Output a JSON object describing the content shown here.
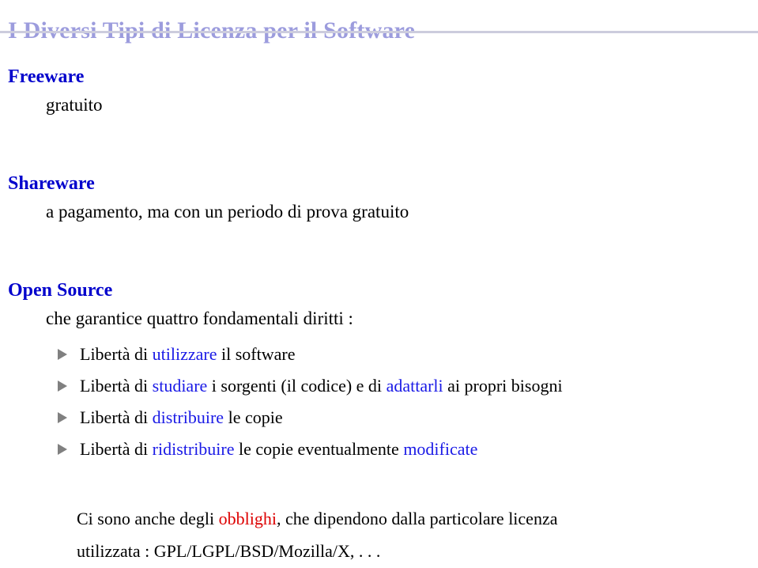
{
  "slide": {
    "title": "I Diversi Tipi di Licenza per il Software",
    "title_color": "#9c9cdd",
    "rule_color": "#ccccdd",
    "heading_color": "#0000cc",
    "keyword_color": "#1a1ae6",
    "obligation_color": "#dd0000",
    "bullet_marker_color": "#808080",
    "bullet_icon": "triangle-right-icon",
    "background": "#ffffff"
  },
  "sections": [
    {
      "heading": "Freeware",
      "body": "gratuito"
    },
    {
      "heading": "Shareware",
      "body": "a pagamento, ma con un periodo di prova gratuito"
    },
    {
      "heading": "Open Source",
      "body": "che garantice quattro fondamentali diritti :"
    }
  ],
  "bullets": [
    {
      "full_text": "Libertà di utilizzare il software",
      "parts": [
        {
          "text": "Libertà di ",
          "style": "plain"
        },
        {
          "text": "utilizzare",
          "style": "keyword"
        },
        {
          "text": " il software",
          "style": "plain"
        }
      ]
    },
    {
      "full_text": "Libertà di studiare i sorgenti (il codice) e di adattarli ai propri bisogni",
      "parts": [
        {
          "text": "Libertà di ",
          "style": "plain"
        },
        {
          "text": "studiare",
          "style": "keyword"
        },
        {
          "text": " i sorgenti (il codice) e di ",
          "style": "plain"
        },
        {
          "text": "adattarli",
          "style": "keyword"
        },
        {
          "text": " ai propri bisogni",
          "style": "plain"
        }
      ]
    },
    {
      "full_text": "Libertà di distribuire le copie",
      "parts": [
        {
          "text": "Libertà di ",
          "style": "plain"
        },
        {
          "text": "distribuire",
          "style": "keyword"
        },
        {
          "text": " le copie",
          "style": "plain"
        }
      ]
    },
    {
      "full_text": "Libertà di ridistribuire le copie eventualmente modificate",
      "parts": [
        {
          "text": "Libertà di ",
          "style": "plain"
        },
        {
          "text": "ridistribuire",
          "style": "keyword"
        },
        {
          "text": " le copie eventualmente ",
          "style": "plain"
        },
        {
          "text": "modificate",
          "style": "keyword"
        }
      ]
    }
  ],
  "closing": {
    "lines": [
      {
        "full_text": "Ci sono anche degli obblighi, che dipendono dalla particolare licenza",
        "parts": [
          {
            "text": "Ci sono anche degli ",
            "style": "plain"
          },
          {
            "text": "obblighi",
            "style": "obligation"
          },
          {
            "text": ", che dipendono dalla particolare licenza",
            "style": "plain"
          }
        ]
      },
      {
        "full_text": "utilizzata : GPL/LGPL/BSD/Mozilla/X, . . .",
        "parts": [
          {
            "text": "utilizzata : GPL/LGPL/BSD/Mozilla/X, . . .",
            "style": "plain"
          }
        ]
      }
    ]
  }
}
